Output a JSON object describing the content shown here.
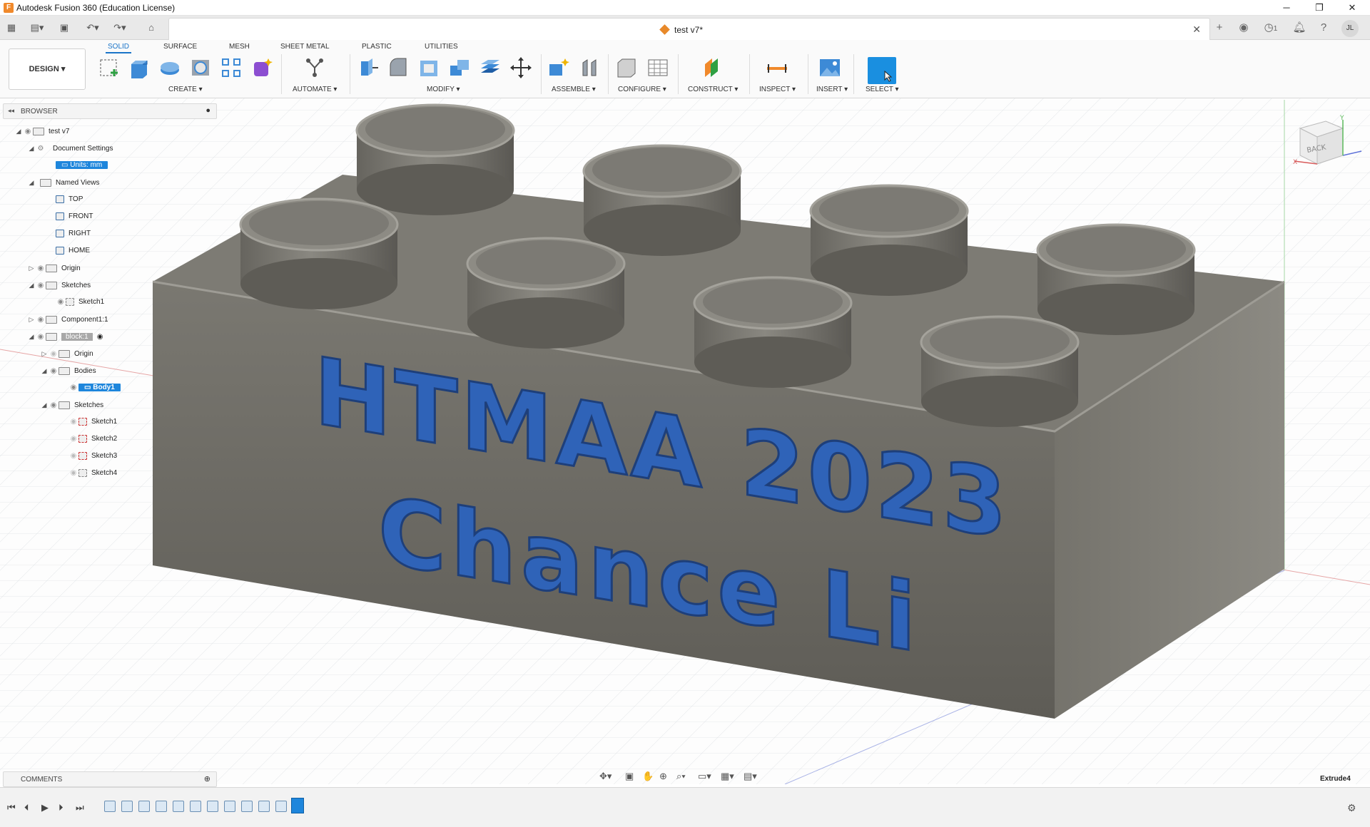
{
  "app": {
    "title": "Autodesk Fusion 360 (Education License)",
    "icon": "fusion-logo-icon"
  },
  "window_controls": {
    "minimize": "─",
    "restore": "❐",
    "close": "✕"
  },
  "document": {
    "tab_title": "test v7*",
    "close": "✕"
  },
  "user": {
    "initials": "JL",
    "jobs_count": "1"
  },
  "ribbon": {
    "tabs": [
      "SOLID",
      "SURFACE",
      "MESH",
      "SHEET METAL",
      "PLASTIC",
      "UTILITIES"
    ],
    "active_tab": "SOLID",
    "workspace": "DESIGN ▾",
    "groups": [
      "CREATE ▾",
      "AUTOMATE ▾",
      "MODIFY ▾",
      "ASSEMBLE ▾",
      "CONFIGURE ▾",
      "CONSTRUCT ▾",
      "INSPECT ▾",
      "INSERT ▾",
      "SELECT ▾"
    ]
  },
  "browser": {
    "title": "BROWSER",
    "items": [
      {
        "label": "test v7",
        "icon": "document-icon"
      },
      {
        "label": "Document Settings",
        "icon": "gear-icon"
      },
      {
        "label": "Units: mm",
        "icon": "units-icon"
      },
      {
        "label": "Named Views",
        "icon": "folder-icon"
      },
      {
        "label": "TOP",
        "icon": "named-view-icon"
      },
      {
        "label": "FRONT",
        "icon": "named-view-icon"
      },
      {
        "label": "RIGHT",
        "icon": "named-view-icon"
      },
      {
        "label": "HOME",
        "icon": "named-view-icon"
      },
      {
        "label": "Origin",
        "icon": "folder-icon"
      },
      {
        "label": "Sketches",
        "icon": "folder-icon"
      },
      {
        "label": "Sketch1",
        "icon": "sketch-icon"
      },
      {
        "label": "Component1:1",
        "icon": "component-icon"
      },
      {
        "label": "block:1",
        "icon": "component-icon"
      },
      {
        "label": "Origin",
        "icon": "folder-icon"
      },
      {
        "label": "Bodies",
        "icon": "folder-icon"
      },
      {
        "label": "Body1",
        "icon": "body-icon"
      },
      {
        "label": "Sketches",
        "icon": "folder-icon"
      },
      {
        "label": "Sketch1",
        "icon": "sketch-icon"
      },
      {
        "label": "Sketch2",
        "icon": "sketch-icon"
      },
      {
        "label": "Sketch3",
        "icon": "sketch-icon"
      },
      {
        "label": "Sketch4",
        "icon": "sketch-icon"
      }
    ]
  },
  "model": {
    "line1": "HTMAA 2023",
    "line2": "Chance Li",
    "text_color": "#2f63b8",
    "body_color": "#6f6d66"
  },
  "viewcube": {
    "face": "BACK",
    "axis_x": "X",
    "axis_y": "Y"
  },
  "comments": {
    "title": "COMMENTS"
  },
  "status": {
    "last_feature": "Extrude4"
  },
  "colors": {
    "accent": "#1e86dc"
  }
}
